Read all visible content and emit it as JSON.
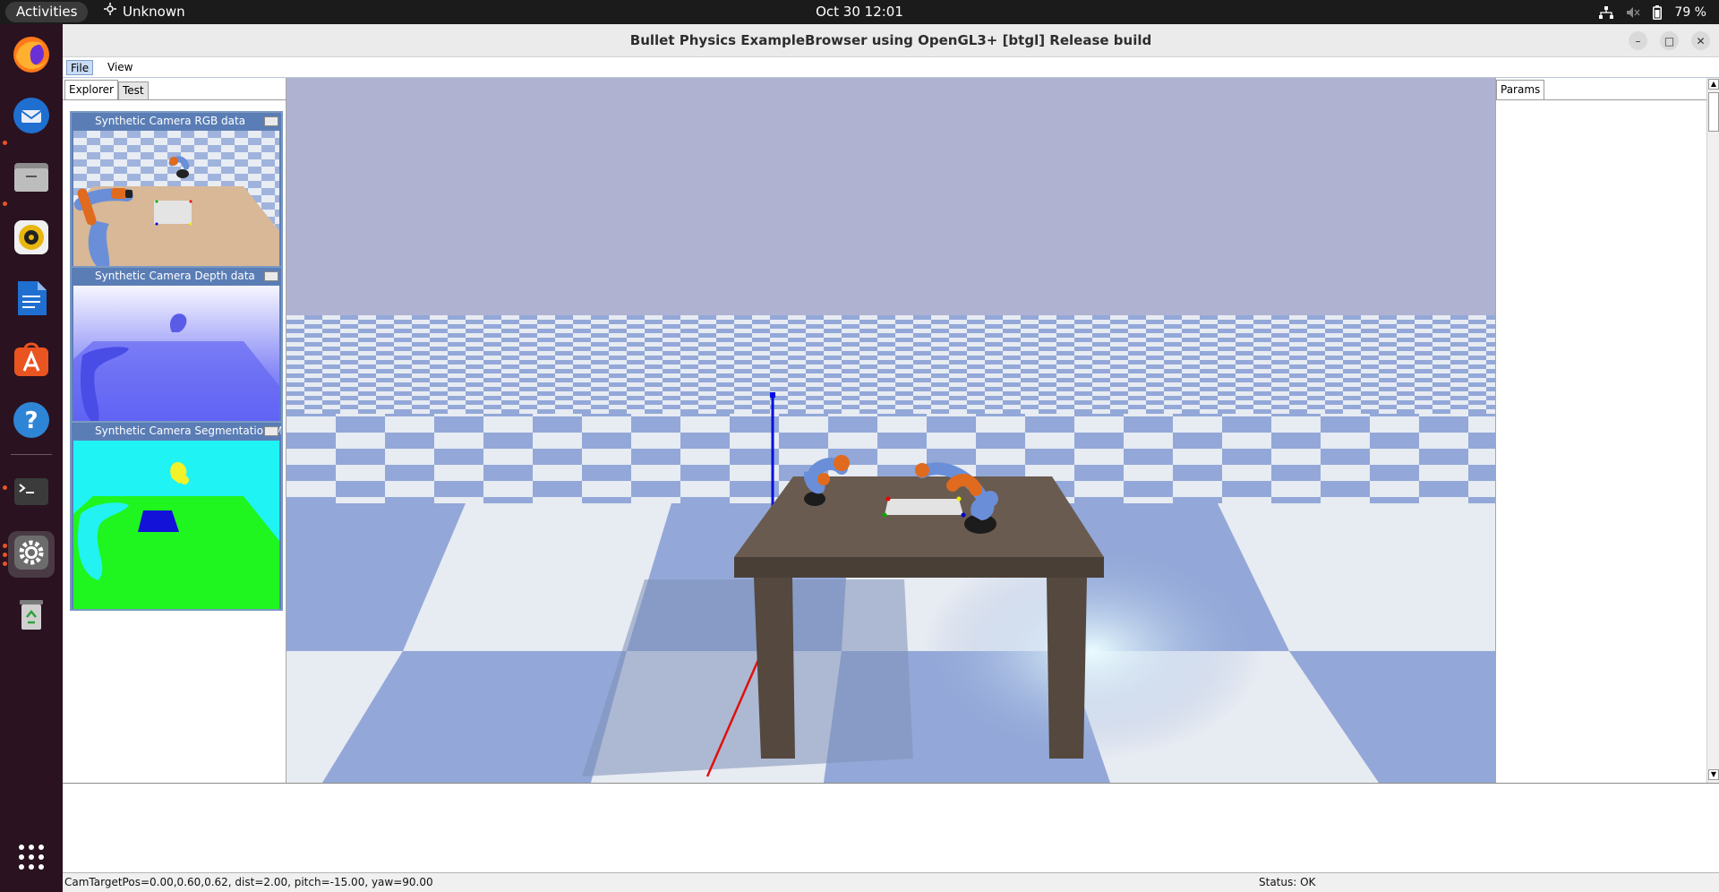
{
  "topbar": {
    "activities": "Activities",
    "app_name": "Unknown",
    "clock": "Oct 30  12:01",
    "battery": "79 %"
  },
  "dock": {
    "items": [
      {
        "icon": "firefox-icon"
      },
      {
        "icon": "thunderbird-icon"
      },
      {
        "icon": "files-icon"
      },
      {
        "icon": "rhythmbox-icon"
      },
      {
        "icon": "writer-icon"
      },
      {
        "icon": "app-center-icon"
      },
      {
        "icon": "help-icon"
      },
      {
        "icon": "terminal-icon"
      },
      {
        "icon": "settings-icon"
      },
      {
        "icon": "trash-icon"
      },
      {
        "icon": "show-apps-icon"
      }
    ]
  },
  "window": {
    "title": "Bullet Physics ExampleBrowser using OpenGL3+ [btgl] Release build"
  },
  "menubar": {
    "file": "File",
    "view": "View"
  },
  "left_panel": {
    "tabs": [
      "Explorer",
      "Test"
    ],
    "cameras": [
      {
        "title": "Synthetic Camera RGB data"
      },
      {
        "title": "Synthetic Camera Depth data"
      },
      {
        "title": "Synthetic Camera Segmentation Mask"
      }
    ]
  },
  "params_panel": {
    "tab": "Params"
  },
  "statusbar": {
    "left": "CamTargetPos=0.00,0.60,0.62, dist=2.00, pitch=-15.00, yaw=90.00",
    "right": "Status: OK"
  },
  "colors": {
    "sky": "#b0b2d2",
    "floor_blue": "#93a8d8",
    "floor_white": "#e7ebf2",
    "table": "#5b4e44",
    "robot_blue": "#6a8fd8",
    "robot_orange": "#e06a1e"
  }
}
